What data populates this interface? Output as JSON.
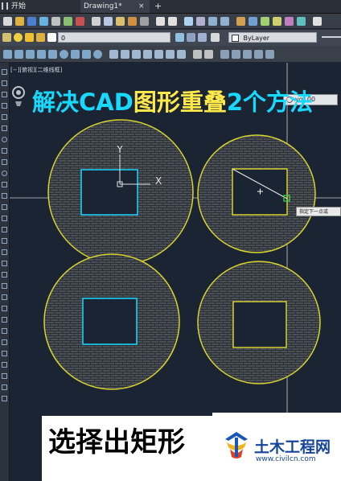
{
  "tabs": {
    "start_label": "开始",
    "drawing_label": "Drawing1*",
    "close_glyph": "×",
    "add_glyph": "+"
  },
  "toolbar": {
    "layer_value": "0",
    "color_value": "ByLayer",
    "search_value": "yq100"
  },
  "viewport": {
    "label": "[−][俯视][二维线框]"
  },
  "canvas": {
    "title_part1": "解决CAD",
    "title_part2": "图形重叠",
    "title_part3": "2个方法",
    "ucs_x": "X",
    "ucs_y": "Y",
    "tooltip": "指定下一点或"
  },
  "caption": {
    "text": "选择出矩形"
  },
  "watermark": {
    "name": "土木工程网",
    "url": "www.civilcn.com"
  },
  "colors": {
    "background": "#1b2433",
    "circle": "#d8d230",
    "hatch": "#3a3f46",
    "rect_cyan": "#17d9ff",
    "rect_yellow": "#d8d230",
    "title_cyan": "#17d9ff",
    "title_yellow": "#ffe94a",
    "logo_blue": "#15449b"
  }
}
